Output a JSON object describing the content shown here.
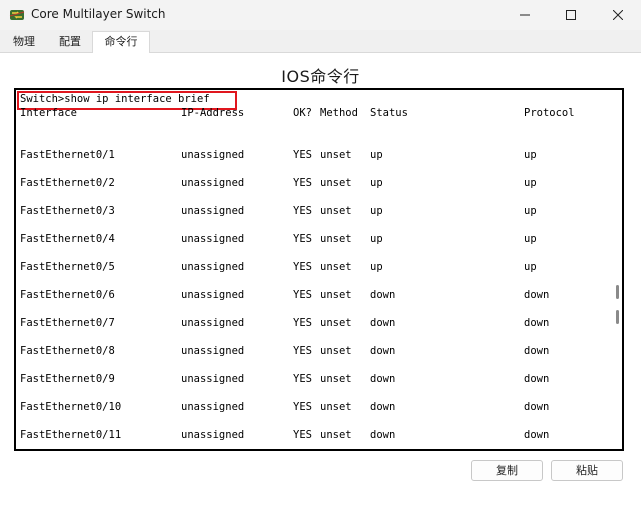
{
  "window": {
    "title": "Core Multilayer Switch",
    "icon": "switch-app-icon",
    "controls": [
      "minimize-icon",
      "maximize-icon",
      "close-icon"
    ]
  },
  "tabs": [
    {
      "label": "物理",
      "active": false
    },
    {
      "label": "配置",
      "active": false
    },
    {
      "label": "命令行",
      "active": true
    }
  ],
  "main": {
    "heading": "IOS命令行"
  },
  "terminal": {
    "command": "Switch>show ip interface brief",
    "highlight_color": "#e0161e",
    "headers": {
      "interface": "Interface",
      "ip": "IP-Address",
      "ok": "OK?",
      "method": "Method",
      "status": "Status",
      "protocol": "Protocol"
    },
    "rows": [
      {
        "interface": "FastEthernet0/1",
        "ip": "unassigned",
        "ok": "YES",
        "method": "unset",
        "status": "up",
        "protocol": "up"
      },
      {
        "interface": "FastEthernet0/2",
        "ip": "unassigned",
        "ok": "YES",
        "method": "unset",
        "status": "up",
        "protocol": "up"
      },
      {
        "interface": "FastEthernet0/3",
        "ip": "unassigned",
        "ok": "YES",
        "method": "unset",
        "status": "up",
        "protocol": "up"
      },
      {
        "interface": "FastEthernet0/4",
        "ip": "unassigned",
        "ok": "YES",
        "method": "unset",
        "status": "up",
        "protocol": "up"
      },
      {
        "interface": "FastEthernet0/5",
        "ip": "unassigned",
        "ok": "YES",
        "method": "unset",
        "status": "up",
        "protocol": "up"
      },
      {
        "interface": "FastEthernet0/6",
        "ip": "unassigned",
        "ok": "YES",
        "method": "unset",
        "status": "down",
        "protocol": "down"
      },
      {
        "interface": "FastEthernet0/7",
        "ip": "unassigned",
        "ok": "YES",
        "method": "unset",
        "status": "down",
        "protocol": "down"
      },
      {
        "interface": "FastEthernet0/8",
        "ip": "unassigned",
        "ok": "YES",
        "method": "unset",
        "status": "down",
        "protocol": "down"
      },
      {
        "interface": "FastEthernet0/9",
        "ip": "unassigned",
        "ok": "YES",
        "method": "unset",
        "status": "down",
        "protocol": "down"
      },
      {
        "interface": "FastEthernet0/10",
        "ip": "unassigned",
        "ok": "YES",
        "method": "unset",
        "status": "down",
        "protocol": "down"
      },
      {
        "interface": "FastEthernet0/11",
        "ip": "unassigned",
        "ok": "YES",
        "method": "unset",
        "status": "down",
        "protocol": "down"
      }
    ]
  },
  "buttons": {
    "copy": "复制",
    "paste": "粘贴"
  }
}
